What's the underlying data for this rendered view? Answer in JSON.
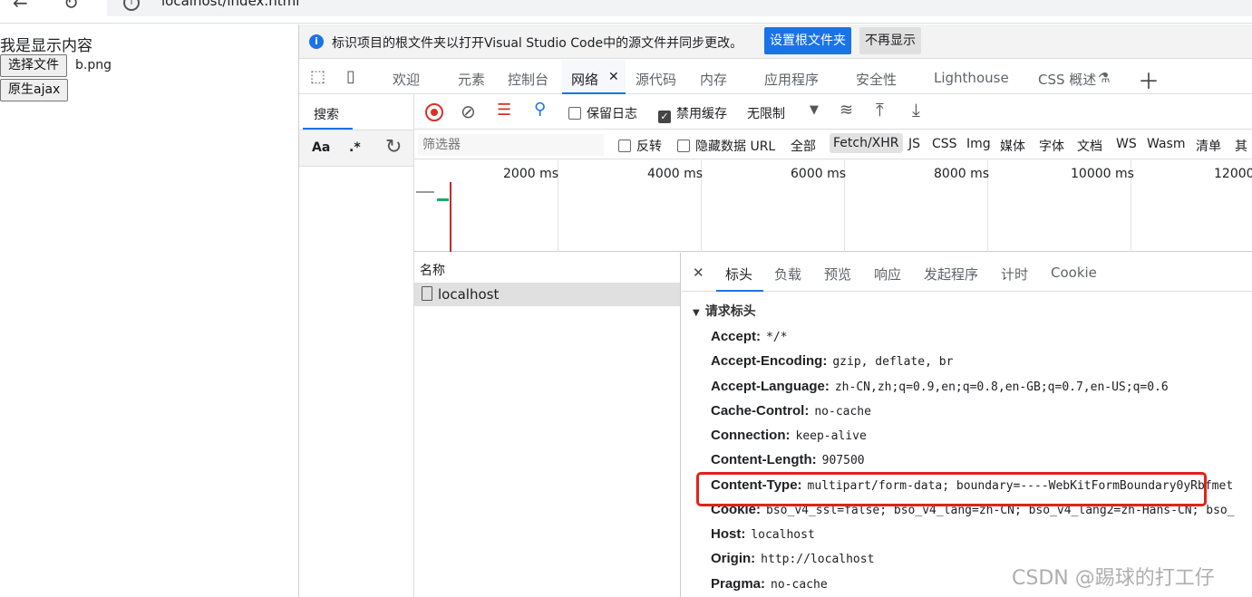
{
  "browser": {
    "url": "localhost/index.html"
  },
  "page": {
    "text": "我是显示内容",
    "file_button": "选择文件",
    "file_name": "b.png",
    "ajax_button": "原生ajax"
  },
  "infobar": {
    "message": "标识项目的根文件夹以打开Visual Studio Code中的源文件并同步更改。",
    "set_root": "设置根文件夹",
    "dismiss": "不再显示"
  },
  "tabs": {
    "welcome": "欢迎",
    "elements": "元素",
    "console": "控制台",
    "network": "网络",
    "sources": "源代码",
    "memory": "内存",
    "application": "应用程序",
    "security": "安全性",
    "lighthouse": "Lighthouse",
    "css_overview": "CSS 概述"
  },
  "search_panel": {
    "tab": "搜索",
    "case": "Aa",
    "regex": ".*"
  },
  "network_toolbar": {
    "preserve_log": "保留日志",
    "disable_cache": "禁用缓存",
    "throttle": "无限制"
  },
  "filter_bar": {
    "placeholder": "筛选器",
    "invert": "反转",
    "hide_data_url": "隐藏数据 URL",
    "types": [
      "全部",
      "Fetch/XHR",
      "JS",
      "CSS",
      "Img",
      "媒体",
      "字体",
      "文档",
      "WS",
      "Wasm",
      "清单",
      "其"
    ]
  },
  "timeline": {
    "labels": [
      "2000 ms",
      "4000 ms",
      "6000 ms",
      "8000 ms",
      "10000 ms",
      "12000"
    ]
  },
  "request_list": {
    "header": "名称",
    "rows": [
      "localhost"
    ]
  },
  "detail_tabs": [
    "标头",
    "负载",
    "预览",
    "响应",
    "发起程序",
    "计时",
    "Cookie"
  ],
  "request_headers": {
    "title": "请求标头",
    "rows": [
      {
        "k": "Accept:",
        "v": "*/*"
      },
      {
        "k": "Accept-Encoding:",
        "v": "gzip, deflate, br"
      },
      {
        "k": "Accept-Language:",
        "v": "zh-CN,zh;q=0.9,en;q=0.8,en-GB;q=0.7,en-US;q=0.6"
      },
      {
        "k": "Cache-Control:",
        "v": "no-cache"
      },
      {
        "k": "Connection:",
        "v": "keep-alive"
      },
      {
        "k": "Content-Length:",
        "v": "907500"
      },
      {
        "k": "Content-Type:",
        "v": "multipart/form-data; boundary=----WebKitFormBoundary0yRbfmet"
      },
      {
        "k": "Cookie:",
        "v": "bso_v4_ssl=false; bso_v4_lang=zh-CN; bso_v4_lang2=zh-Hans-CN; bso_"
      },
      {
        "k": "Host:",
        "v": "localhost"
      },
      {
        "k": "Origin:",
        "v": "http://localhost"
      },
      {
        "k": "Pragma:",
        "v": "no-cache"
      }
    ]
  },
  "watermark": "CSDN @踢球的打工仔",
  "colors": {
    "accent": "#1a73e8",
    "highlight_box": "#e32119",
    "record": "#d93025"
  }
}
